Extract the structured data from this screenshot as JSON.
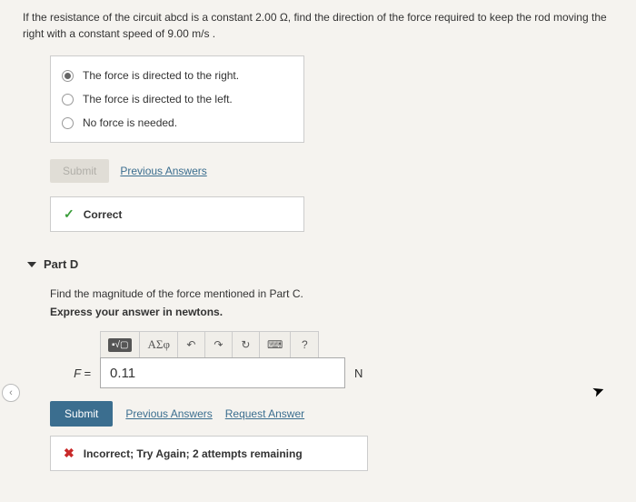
{
  "question": "If the resistance of the circuit abcd is a constant 2.00 Ω, find the direction of the force required to keep the rod moving the right with a constant speed of 9.00 m/s .",
  "options": [
    {
      "label": "The force is directed to the right.",
      "selected": true
    },
    {
      "label": "The force is directed to the left.",
      "selected": false
    },
    {
      "label": "No force is needed.",
      "selected": false
    }
  ],
  "submit_disabled_label": "Submit",
  "prev_answers_label": "Previous Answers",
  "correct_label": "Correct",
  "partD": {
    "title": "Part D",
    "instruction": "Find the magnitude of the force mentioned in Part C.",
    "sub_instruction": "Express your answer in newtons.",
    "greek_label": "ΑΣφ",
    "help_label": "?",
    "variable": "F =",
    "value": "0.11",
    "unit": "N",
    "submit_label": "Submit",
    "prev_answers": "Previous Answers",
    "request_answer": "Request Answer",
    "incorrect_msg": "Incorrect; Try Again; 2 attempts remaining"
  }
}
